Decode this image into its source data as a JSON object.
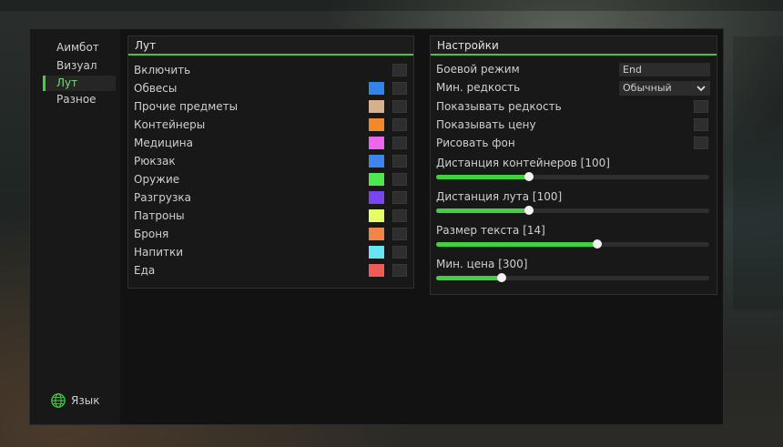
{
  "sidebar": {
    "items": [
      {
        "label": "Аимбот",
        "active": false
      },
      {
        "label": "Визуал",
        "active": false
      },
      {
        "label": "Лут",
        "active": true
      },
      {
        "label": "Разное",
        "active": false
      }
    ],
    "language_label": "Язык"
  },
  "loot_panel": {
    "title": "Лут",
    "rows": [
      {
        "label": "Включить",
        "color": null,
        "checked": false
      },
      {
        "label": "Обвесы",
        "color": "#2f86e8",
        "checked": false
      },
      {
        "label": "Прочие предметы",
        "color": "#d8b08c",
        "checked": false
      },
      {
        "label": "Контейнеры",
        "color": "#f28a2c",
        "checked": false
      },
      {
        "label": "Медицина",
        "color": "#ee66ee",
        "checked": false
      },
      {
        "label": "Рюкзак",
        "color": "#3d86ef",
        "checked": false
      },
      {
        "label": "Оружие",
        "color": "#4ee84e",
        "checked": false
      },
      {
        "label": "Разгрузка",
        "color": "#7a44ef",
        "checked": false
      },
      {
        "label": "Патроны",
        "color": "#e6ff66",
        "checked": false
      },
      {
        "label": "Броня",
        "color": "#f08449",
        "checked": false
      },
      {
        "label": "Напитки",
        "color": "#66e6f2",
        "checked": false
      },
      {
        "label": "Еда",
        "color": "#ee5c56",
        "checked": false
      }
    ]
  },
  "settings_panel": {
    "title": "Настройки",
    "combat_mode": {
      "label": "Боевой режим",
      "key": "End"
    },
    "min_rarity": {
      "label": "Мин. редкость",
      "value": "Обычный"
    },
    "checks": [
      {
        "label": "Показывать редкость",
        "checked": false
      },
      {
        "label": "Показывать цену",
        "checked": false
      },
      {
        "label": "Рисовать фон",
        "checked": false
      }
    ],
    "sliders": [
      {
        "label": "Дистанция контейнеров [100]",
        "fraction": 0.34
      },
      {
        "label": "Дистанция лута [100]",
        "fraction": 0.34
      },
      {
        "label": "Размер текста [14]",
        "fraction": 0.59
      },
      {
        "label": "Мин. цена [300]",
        "fraction": 0.24
      }
    ]
  },
  "colors": {
    "accent": "#40d040",
    "panel_bg": "#181818"
  }
}
